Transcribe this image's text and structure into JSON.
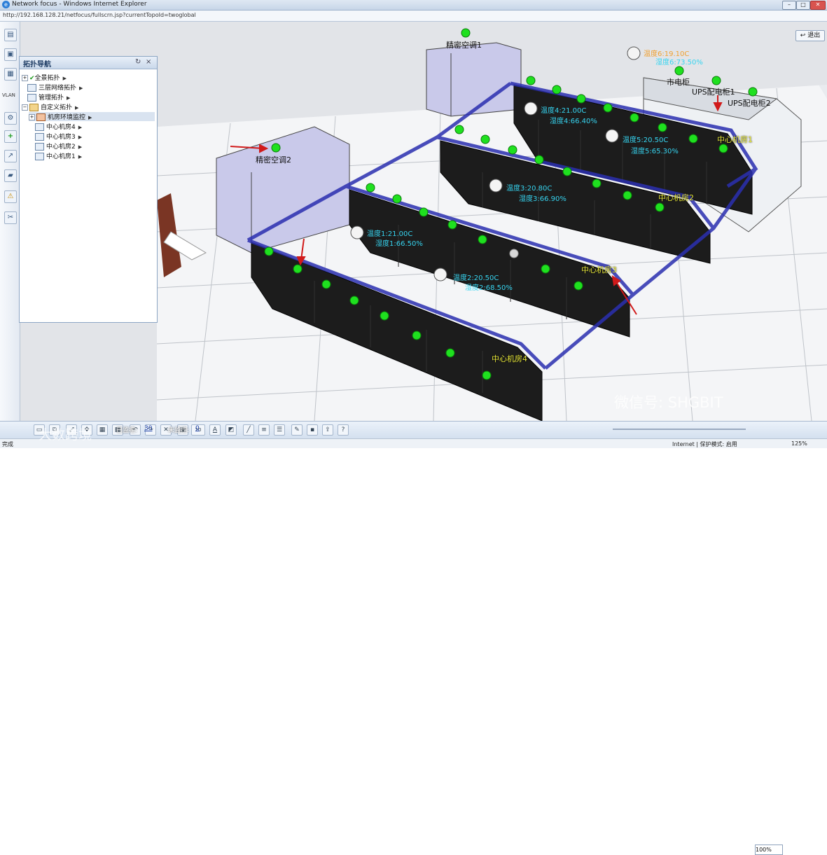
{
  "window": {
    "title": "Network focus - Windows Internet Explorer",
    "minimize": "–",
    "maximize": "□",
    "close": "✕"
  },
  "addressbar": {
    "url": "http://192.168.128.21/netfocus/fullscrn.jsp?currentTopoId=twoglobal"
  },
  "sidebar_tools": {
    "vlan_label": "VLAN"
  },
  "exit_button": {
    "label": "退出"
  },
  "nav_panel": {
    "title": "拓扑导航",
    "refresh": "↻",
    "close": "×",
    "tree": [
      {
        "label": "全景拓扑"
      },
      {
        "label": "三层网络拓扑"
      },
      {
        "label": "管理拓扑"
      },
      {
        "label": "自定义拓扑"
      },
      {
        "label": "机房环境监控"
      },
      {
        "label": "中心机房4"
      },
      {
        "label": "中心机房3"
      },
      {
        "label": "中心机房2"
      },
      {
        "label": "中心机房1"
      }
    ]
  },
  "scene": {
    "ac_units": [
      {
        "label": "精密空调1"
      },
      {
        "label": "精密空调2"
      }
    ],
    "power": [
      {
        "label": "市电柜"
      },
      {
        "label": "UPS配电柜1"
      },
      {
        "label": "UPS配电柜2"
      }
    ],
    "rooms": [
      {
        "label": "中心机房1"
      },
      {
        "label": "中心机房2"
      },
      {
        "label": "中心机房3"
      },
      {
        "label": "中心机房4"
      }
    ],
    "sensors": [
      {
        "temp": "温度1:21.00C",
        "hum": "湿度1:66.50%"
      },
      {
        "temp": "温度2:20.50C",
        "hum": "湿度2:68.50%"
      },
      {
        "temp": "温度3:20.80C",
        "hum": "湿度3:66.90%"
      },
      {
        "temp": "温度4:21.00C",
        "hum": "湿度4:66.40%"
      },
      {
        "temp": "温度5:20.50C",
        "hum": "湿度5:65.30%"
      },
      {
        "temp": "温度6:19.10C",
        "hum": "湿度6:73.50%"
      }
    ],
    "status_colors": {
      "online": "#1fe01f",
      "unknown": "#d8d8d8"
    }
  },
  "bottom_bar": {
    "monitored_label": "已监控:",
    "monitored_value": "30",
    "unmonitored_label": "未监控:",
    "unmonitored_value": "0",
    "font_size_value": "20",
    "zoom_value": "100%"
  },
  "statusbar": {
    "left": "完成",
    "zone": "Internet | 保护模式: 启用",
    "zoom": "125%"
  },
  "watermarks": {
    "left": "大数跨境",
    "right": "微信号: SHGBIT"
  }
}
